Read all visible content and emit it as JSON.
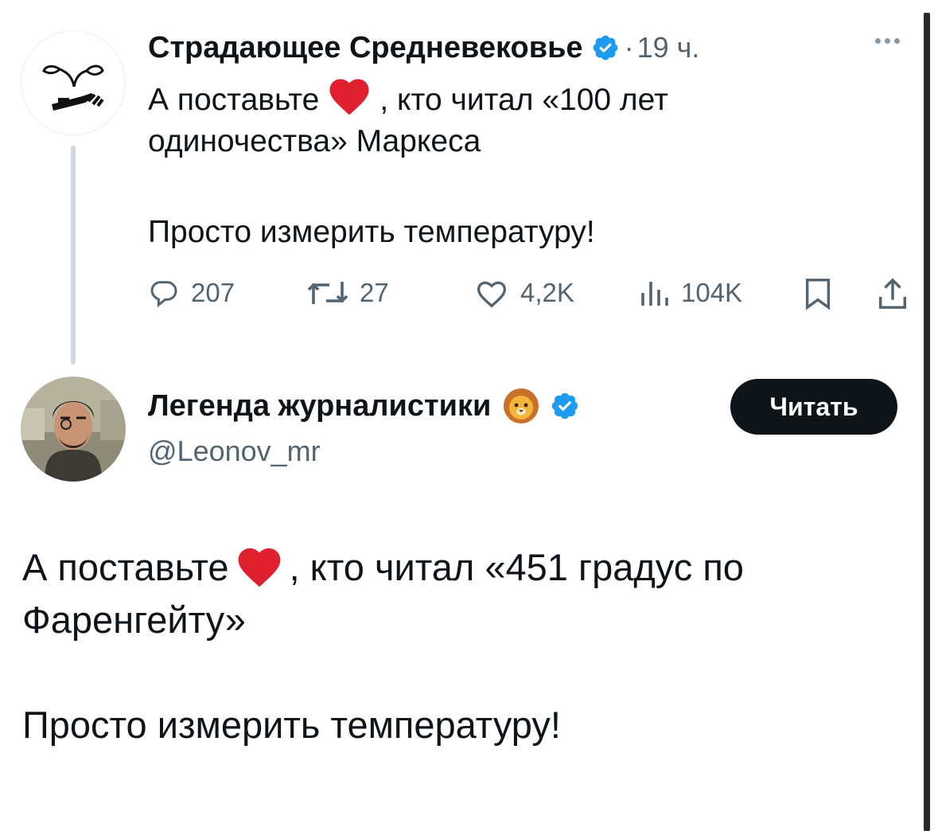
{
  "parent_tweet": {
    "author_name": "Страдающее Средневековье",
    "separator": "·",
    "time": "19 ч.",
    "text_line1_before": "А поставьте",
    "text_line1_after": ", кто читал «100 лет",
    "text_line2": "одиночества» Маркеса",
    "text_line3": "Просто измерить температуру!",
    "replies": "207",
    "retweets": "27",
    "likes": "4,2K",
    "views": "104K"
  },
  "quote_tweet": {
    "author_name": "Легенда журналистики",
    "handle": "@Leonov_mr",
    "follow_label": "Читать",
    "text_line1_before": "А поставьте",
    "text_line1_after": ", кто читал «451 градус по",
    "text_line2": "Фаренгейту»",
    "text_line3": "Просто измерить температуру!"
  },
  "icons": [
    "more-icon",
    "verified-badge-icon",
    "heart-emoji-icon",
    "reply-icon",
    "retweet-icon",
    "like-icon",
    "views-icon",
    "bookmark-icon",
    "share-icon",
    "lion-emoji-icon"
  ],
  "colors": {
    "text": "#0f1419",
    "secondary": "#536471",
    "verified": "#1d9bf0",
    "heart": "#e0202f",
    "button_bg": "#0f1419"
  }
}
